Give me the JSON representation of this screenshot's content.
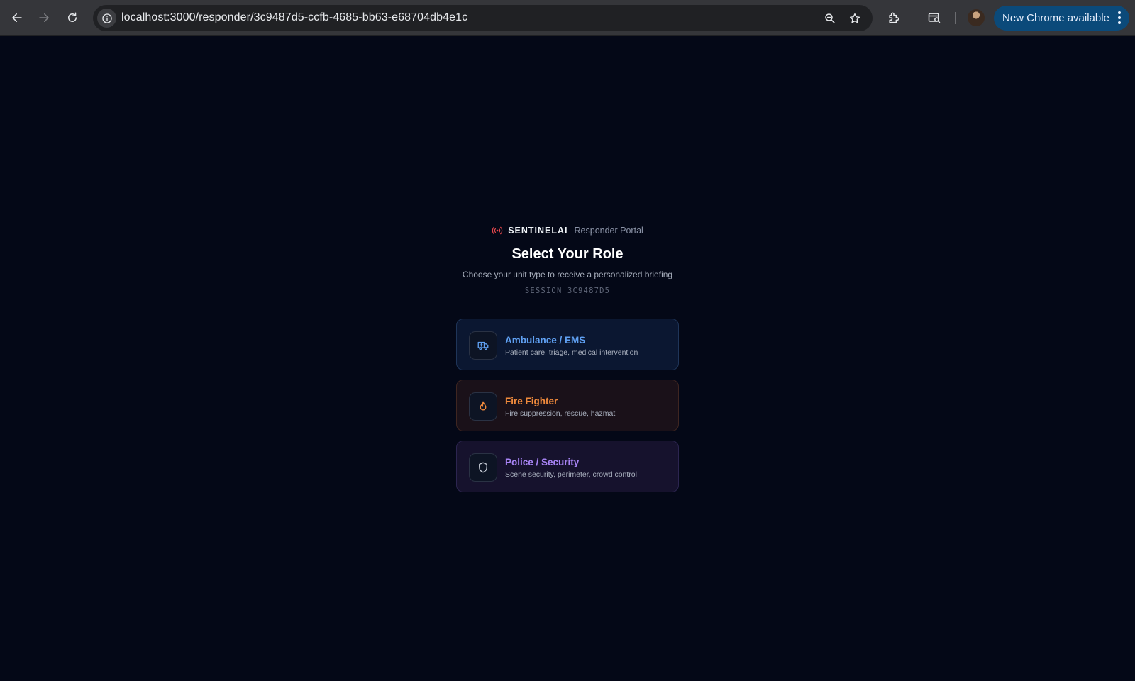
{
  "browser": {
    "url": "localhost:3000/responder/3c9487d5-ccfb-4685-bb63-e68704db4e1c",
    "update_label": "New Chrome available",
    "icons": [
      "back-arrow-icon",
      "forward-arrow-icon",
      "reload-icon",
      "site-info-icon",
      "zoom-icon",
      "bookmark-star-icon",
      "extensions-icon",
      "tab-search-icon",
      "profile-avatar",
      "more-menu-icon"
    ]
  },
  "brand": {
    "name": "SENTINELAI",
    "portal": "Responder Portal",
    "icon": "broadcast-icon",
    "icon_color": "#e5484d"
  },
  "header": {
    "title": "Select Your Role",
    "subtitle": "Choose your unit type to receive a personalized briefing",
    "session": "SESSION 3C9487D5"
  },
  "roles": [
    {
      "title": "Ambulance / EMS",
      "description": "Patient care, triage, medical intervention",
      "icon": "ambulance-icon",
      "color": "#5fa0f2"
    },
    {
      "title": "Fire Fighter",
      "description": "Fire suppression, rescue, hazmat",
      "icon": "flame-icon",
      "color": "#f08a3c"
    },
    {
      "title": "Police / Security",
      "description": "Scene security, perimeter, crowd control",
      "icon": "shield-icon",
      "color": "#a884f5"
    }
  ]
}
